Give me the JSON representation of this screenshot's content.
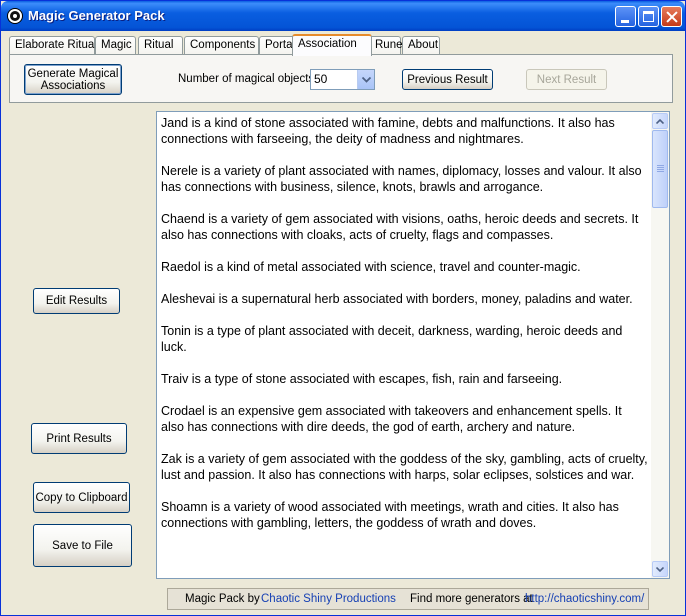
{
  "window": {
    "title": "Magic Generator Pack"
  },
  "tabs": [
    {
      "label": "Elaborate Ritual"
    },
    {
      "label": "Magic"
    },
    {
      "label": "Ritual"
    },
    {
      "label": "Components"
    },
    {
      "label": "Portal"
    },
    {
      "label": "Association",
      "active": true
    },
    {
      "label": "Rune"
    },
    {
      "label": "About"
    }
  ],
  "toolbar": {
    "generate_label": "Generate Magical Associations",
    "count_label": "Number of magical objects:",
    "count_value": "50",
    "previous_label": "Previous Result",
    "next_label": "Next Result"
  },
  "side_buttons": {
    "edit": "Edit Results",
    "print": "Print Results",
    "copy": "Copy to Clipboard",
    "save": "Save to File"
  },
  "results": [
    "Jand is a kind of stone associated with famine, debts and malfunctions. It also has connections with farseeing, the deity of madness and nightmares.",
    "Nerele is a variety of plant associated with names, diplomacy, losses and valour. It also has connections with business, silence, knots, brawls and arrogance.",
    "Chaend is a variety of gem associated with visions, oaths, heroic deeds and secrets. It also has connections with cloaks, acts of cruelty, flags and compasses.",
    "Raedol is a kind of metal associated with science, travel and counter-magic.",
    "Aleshevai is a supernatural herb associated with borders, money, paladins and water.",
    "Tonin is a type of plant associated with deceit, darkness, warding, heroic deeds and luck.",
    "Traiv is a type of stone associated with escapes, fish, rain and farseeing.",
    "Crodael is an expensive gem associated with takeovers and enhancement spells. It also has connections with dire deeds, the god of earth, archery and nature.",
    "Zak is a variety of gem associated with the goddess of the sky, gambling, acts of cruelty, lust and passion. It also has connections with harps, solar eclipses, solstices and war.",
    "Shoamn is a variety of wood associated with meetings, wrath and cities. It also has connections with gambling, letters, the goddess of wrath and doves."
  ],
  "status": {
    "credit_prefix": "Magic Pack by",
    "credit_link": "Chaotic Shiny Productions",
    "more_prefix": "Find more generators at",
    "more_link": "http://chaoticshiny.com/"
  },
  "colors": {
    "titlebar": "#0a5ee0",
    "active_tab_accent": "#e68b2c",
    "link": "#1640b4"
  }
}
